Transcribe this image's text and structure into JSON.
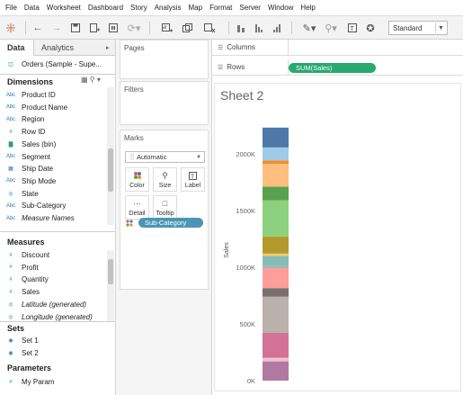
{
  "menu": [
    "File",
    "Data",
    "Worksheet",
    "Dashboard",
    "Story",
    "Analysis",
    "Map",
    "Format",
    "Server",
    "Window",
    "Help"
  ],
  "toolbar": {
    "fit": "Standard",
    "icons": [
      "tableau-logo-icon",
      "back-icon",
      "forward-icon",
      "save-icon",
      "new-datasource-icon",
      "pause-icon",
      "refresh-icon",
      "new-worksheet-icon",
      "duplicate-icon",
      "clear-icon",
      "swap-icon",
      "sort-asc-icon",
      "sort-desc-icon",
      "highlight-icon",
      "annotate-icon",
      "label-icon",
      "fix-axes-icon"
    ]
  },
  "data_tabs": {
    "data": "Data",
    "analytics": "Analytics"
  },
  "datasource": "Orders (Sample - Supe...",
  "dimensions_title": "Dimensions",
  "dimensions": [
    {
      "type": "Abc",
      "label": "Product ID"
    },
    {
      "type": "Abc",
      "label": "Product Name"
    },
    {
      "type": "Abc",
      "label": "Region"
    },
    {
      "type": "#",
      "label": "Row ID"
    },
    {
      "type": "bin",
      "label": "Sales (bin)"
    },
    {
      "type": "Abc",
      "label": "Segment"
    },
    {
      "type": "date",
      "label": "Ship Date"
    },
    {
      "type": "Abc",
      "label": "Ship Mode"
    },
    {
      "type": "globe",
      "label": "State"
    },
    {
      "type": "Abc",
      "label": "Sub-Category"
    },
    {
      "type": "Abc",
      "label": "Measure Names"
    }
  ],
  "measures_title": "Measures",
  "measures": [
    {
      "type": "#",
      "label": "Discount"
    },
    {
      "type": "#",
      "label": "Profit"
    },
    {
      "type": "#",
      "label": "Quantity"
    },
    {
      "type": "#",
      "label": "Sales"
    },
    {
      "type": "globe",
      "label": "Latitude (generated)"
    },
    {
      "type": "globe",
      "label": "Longitude (generated)"
    }
  ],
  "sets_title": "Sets",
  "sets": [
    {
      "label": "Set 1"
    },
    {
      "label": "Set 2"
    }
  ],
  "parameters_title": "Parameters",
  "parameters": [
    {
      "label": "My Param"
    }
  ],
  "cards": {
    "pages": "Pages",
    "filters": "Filters",
    "marks": "Marks",
    "marks_type": "Automatic"
  },
  "mark_buttons": {
    "color": "Color",
    "size": "Size",
    "label": "Label",
    "detail": "Detail",
    "tooltip": "Tooltip"
  },
  "marks_pill": "Sub-Category",
  "shelves": {
    "columns": "Columns",
    "rows": "Rows",
    "rows_pill": "SUM(Sales)"
  },
  "sheet_title": "Sheet 2",
  "chart_data": {
    "type": "bar",
    "stacked": true,
    "categories": [
      ""
    ],
    "ylabel": "Sales",
    "ylim": [
      0,
      2300000
    ],
    "yticks": [
      0,
      500000,
      1000000,
      1500000,
      2000000
    ],
    "ytick_labels": [
      "0K",
      "500K",
      "1000K",
      "1500K",
      "2000K"
    ],
    "segments": [
      {
        "value": 170000,
        "color": "#b07aa1"
      },
      {
        "value": 30000,
        "color": "#f1c2d6"
      },
      {
        "value": 220000,
        "color": "#d37295"
      },
      {
        "value": 320000,
        "color": "#bab0ac"
      },
      {
        "value": 75000,
        "color": "#79706e"
      },
      {
        "value": 180000,
        "color": "#ff9d9a"
      },
      {
        "value": 15000,
        "color": "#86bcb6"
      },
      {
        "value": 90000,
        "color": "#86bcb6"
      },
      {
        "value": 20000,
        "color": "#f1ce63"
      },
      {
        "value": 150000,
        "color": "#b6992d"
      },
      {
        "value": 320000,
        "color": "#8cd17d"
      },
      {
        "value": 120000,
        "color": "#59a14f"
      },
      {
        "value": 200000,
        "color": "#ffbe7d"
      },
      {
        "value": 30000,
        "color": "#f28e2b"
      },
      {
        "value": 115000,
        "color": "#a0cbe8"
      },
      {
        "value": 175000,
        "color": "#4e79a7"
      }
    ]
  }
}
